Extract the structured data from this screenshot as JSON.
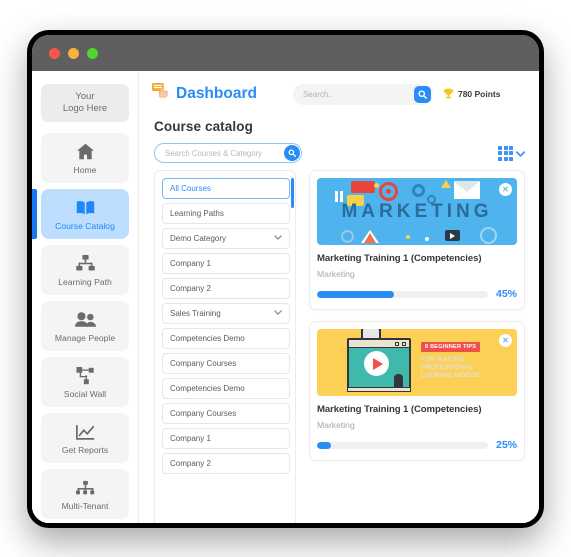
{
  "window": {
    "dots": [
      "close-red",
      "minimize-yellow",
      "maximize-green"
    ]
  },
  "sidebar": {
    "logo": {
      "line1": "Your",
      "line2": "Logo Here"
    },
    "items": [
      {
        "label": "Home",
        "icon": "home-icon",
        "active": false
      },
      {
        "label": "Course Catalog",
        "icon": "book-icon",
        "active": true
      },
      {
        "label": "Learning Path",
        "icon": "sitemap-icon",
        "active": false
      },
      {
        "label": "Manage People",
        "icon": "people-icon",
        "active": false
      },
      {
        "label": "Social Wall",
        "icon": "share-nodes-icon",
        "active": false
      },
      {
        "label": "Get Reports",
        "icon": "chart-line-icon",
        "active": false
      },
      {
        "label": "Multi-Tenant",
        "icon": "org-chart-icon",
        "active": false
      }
    ]
  },
  "topbar": {
    "brand": "Dashboard",
    "brand_icon": "hand-click-card-icon",
    "search": {
      "placeholder": "Search..",
      "value": "",
      "button_icon": "search-icon"
    },
    "points": {
      "icon": "trophy-icon",
      "label": "780 Points"
    }
  },
  "catalog": {
    "title": "Course catalog",
    "search": {
      "placeholder": "Search Courses & Category",
      "value": "",
      "button_icon": "search-icon"
    },
    "view_toggle": {
      "icon": "grid-view-icon",
      "chevron": "chevron-down-icon"
    }
  },
  "categories": [
    {
      "label": "All Courses",
      "selected": true,
      "expandable": false
    },
    {
      "label": "Learning Paths",
      "selected": false,
      "expandable": false
    },
    {
      "label": "Demo Category",
      "selected": false,
      "expandable": true
    },
    {
      "label": "Company 1",
      "selected": false,
      "expandable": false
    },
    {
      "label": "Company 2",
      "selected": false,
      "expandable": false
    },
    {
      "label": "Sales Training",
      "selected": false,
      "expandable": true
    },
    {
      "label": "Competencies Demo",
      "selected": false,
      "expandable": false
    },
    {
      "label": "Company Courses",
      "selected": false,
      "expandable": false
    },
    {
      "label": "Competencies Demo",
      "selected": false,
      "expandable": false
    },
    {
      "label": "Company Courses",
      "selected": false,
      "expandable": false
    },
    {
      "label": "Company 1",
      "selected": false,
      "expandable": false
    },
    {
      "label": "Company 2",
      "selected": false,
      "expandable": false
    }
  ],
  "courses": [
    {
      "title": "Marketing Training 1 (Competencies)",
      "category": "Marketing",
      "progress": 45,
      "progress_label": "45%",
      "thumbnail": "marketing-banner",
      "thumbnail_text": "MARKETING",
      "close_icon": "close-circle-icon"
    },
    {
      "title": "Marketing Training 1 (Competencies)",
      "category": "Marketing",
      "progress": 25,
      "progress_label": "25%",
      "thumbnail": "video-tips-banner",
      "thumbnail_tag": "8 BEGINNER TIPS",
      "thumbnail_lines": "FOR MAKING\nPROFESSIONAL\nLOOKING VIDEOS",
      "close_icon": "close-circle-icon"
    }
  ],
  "colors": {
    "accent": "#2a8cf5",
    "accent_soft": "#bedeff",
    "titlebar": "#5f5f5f",
    "marketing_thumb": "#4fb3ee",
    "video_thumb": "#fbd055",
    "progress_track": "#eff0f1"
  }
}
